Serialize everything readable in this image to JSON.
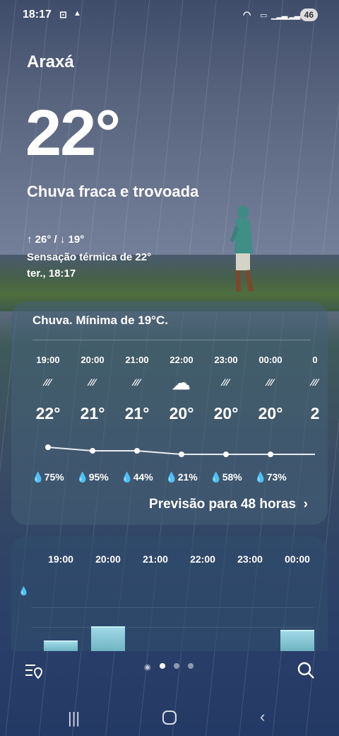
{
  "status_bar": {
    "time": "18:17",
    "battery": "46"
  },
  "weather": {
    "city": "Araxá",
    "temperature": "22°",
    "condition": "Chuva fraca e trovoada",
    "min_max": "↑ 26° / ↓ 19°",
    "feels_like": "Sensação térmica de 22°",
    "date_time": "ter., 18:17"
  },
  "hourly_card": {
    "title": "Chuva. Mínima de 19°C.",
    "more_link": "Previsão para 48 horas",
    "hours": [
      {
        "time": "19:00",
        "icon": "rain-icon",
        "temp": "22°",
        "precip": "75%",
        "temp_value": 22
      },
      {
        "time": "20:00",
        "icon": "rain-icon",
        "temp": "21°",
        "precip": "95%",
        "temp_value": 21
      },
      {
        "time": "21:00",
        "icon": "rain-icon",
        "temp": "21°",
        "precip": "44%",
        "temp_value": 21
      },
      {
        "time": "22:00",
        "icon": "cloud-icon",
        "temp": "20°",
        "precip": "21%",
        "temp_value": 20
      },
      {
        "time": "23:00",
        "icon": "rain-icon",
        "temp": "20°",
        "precip": "58%",
        "temp_value": 20
      },
      {
        "time": "00:00",
        "icon": "rain-icon",
        "temp": "20°",
        "precip": "73%",
        "temp_value": 20
      },
      {
        "time": "0",
        "icon": "rain-icon",
        "temp": "2",
        "precip": "",
        "temp_value": 20
      }
    ]
  },
  "precip_card": {
    "hours": [
      "19:00",
      "20:00",
      "21:00",
      "22:00",
      "23:00",
      "00:00"
    ],
    "amounts": [
      0.35,
      0.8,
      0,
      0,
      0,
      0.68
    ]
  },
  "colors": {
    "accent": "#9fd8e6",
    "card": "#466076"
  }
}
